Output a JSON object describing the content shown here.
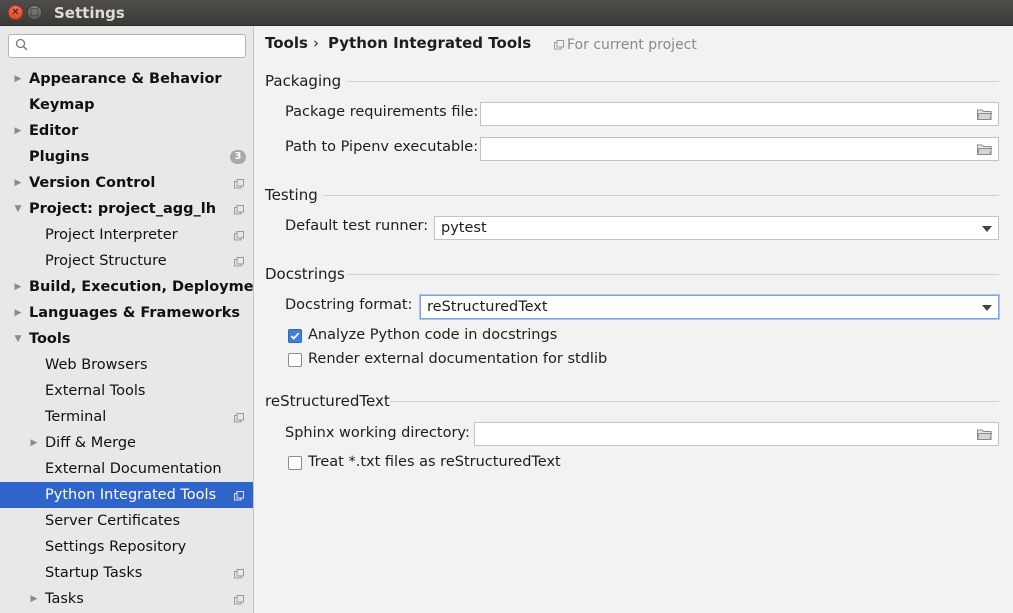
{
  "window": {
    "title": "Settings"
  },
  "search": {
    "placeholder": "",
    "value": ""
  },
  "sidebar": {
    "items": [
      {
        "label": "Appearance & Behavior",
        "bold": true,
        "arrow": "right",
        "level": 0,
        "copy": false
      },
      {
        "label": "Keymap",
        "bold": true,
        "arrow": "",
        "level": 0,
        "copy": false
      },
      {
        "label": "Editor",
        "bold": true,
        "arrow": "right",
        "level": 0,
        "copy": false
      },
      {
        "label": "Plugins",
        "bold": true,
        "arrow": "",
        "level": 0,
        "copy": false,
        "badge": "3"
      },
      {
        "label": "Version Control",
        "bold": true,
        "arrow": "right",
        "level": 0,
        "copy": true
      },
      {
        "label": "Project: project_agg_lh",
        "bold": true,
        "arrow": "down",
        "level": 0,
        "copy": true
      },
      {
        "label": "Project Interpreter",
        "bold": false,
        "arrow": "",
        "level": 1,
        "copy": true
      },
      {
        "label": "Project Structure",
        "bold": false,
        "arrow": "",
        "level": 1,
        "copy": true
      },
      {
        "label": "Build, Execution, Deployment",
        "bold": true,
        "arrow": "right",
        "level": 0,
        "copy": false
      },
      {
        "label": "Languages & Frameworks",
        "bold": true,
        "arrow": "right",
        "level": 0,
        "copy": false
      },
      {
        "label": "Tools",
        "bold": true,
        "arrow": "down",
        "level": 0,
        "copy": false
      },
      {
        "label": "Web Browsers",
        "bold": false,
        "arrow": "",
        "level": 1,
        "copy": false
      },
      {
        "label": "External Tools",
        "bold": false,
        "arrow": "",
        "level": 1,
        "copy": false
      },
      {
        "label": "Terminal",
        "bold": false,
        "arrow": "",
        "level": 1,
        "copy": true
      },
      {
        "label": "Diff & Merge",
        "bold": false,
        "arrow": "right",
        "level": 1,
        "copy": false
      },
      {
        "label": "External Documentation",
        "bold": false,
        "arrow": "",
        "level": 1,
        "copy": false
      },
      {
        "label": "Python Integrated Tools",
        "bold": false,
        "arrow": "",
        "level": 1,
        "copy": true,
        "selected": true
      },
      {
        "label": "Server Certificates",
        "bold": false,
        "arrow": "",
        "level": 1,
        "copy": false
      },
      {
        "label": "Settings Repository",
        "bold": false,
        "arrow": "",
        "level": 1,
        "copy": false
      },
      {
        "label": "Startup Tasks",
        "bold": false,
        "arrow": "",
        "level": 1,
        "copy": true
      },
      {
        "label": "Tasks",
        "bold": false,
        "arrow": "right",
        "level": 1,
        "copy": true
      }
    ]
  },
  "breadcrumb": {
    "root": "Tools",
    "separator": "›",
    "page": "Python Integrated Tools",
    "scope": "For current project"
  },
  "packaging": {
    "title": "Packaging",
    "requirements_label": "Package requirements file:",
    "requirements_value": "",
    "pipenv_label": "Path to Pipenv executable:",
    "pipenv_value": ""
  },
  "testing": {
    "title": "Testing",
    "runner_label": "Default test runner:",
    "runner_value": "pytest"
  },
  "docstrings": {
    "title": "Docstrings",
    "format_label": "Docstring format:",
    "format_value": "reStructuredText",
    "analyze_label": "Analyze Python code in docstrings",
    "analyze_checked": true,
    "render_label": "Render external documentation for stdlib",
    "render_checked": false
  },
  "rest": {
    "title": "reStructuredText",
    "sphinx_label": "Sphinx working directory:",
    "sphinx_value": "",
    "txt_label": "Treat *.txt files as reStructuredText",
    "txt_checked": false
  },
  "colors": {
    "selection": "#2f65ca",
    "checkbox_on": "#3f7fd6"
  }
}
